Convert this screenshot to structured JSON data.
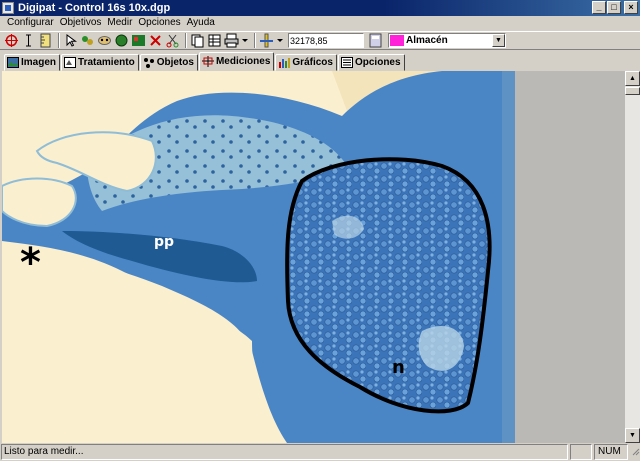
{
  "window": {
    "title": "Digipat - Control 16s 10x.dgp",
    "minimize": "_",
    "maximize": "□",
    "close": "×"
  },
  "menu": [
    "Configurar",
    "Objetivos",
    "Medir",
    "Opciones",
    "Ayuda"
  ],
  "toolbar": {
    "coord_value": "32178,85",
    "combo_value": "Almacén",
    "combo_swatch": "#ff22d8"
  },
  "tabs": [
    {
      "label": "Imagen"
    },
    {
      "label": "Tratamiento"
    },
    {
      "label": "Objetos"
    },
    {
      "label": "Mediciones",
      "active": true
    },
    {
      "label": "Gráficos"
    },
    {
      "label": "Opciones"
    }
  ],
  "image": {
    "labels": {
      "asterisk": "*",
      "pp": "pp",
      "n": "n"
    }
  },
  "status": {
    "text": "Listo para medir...",
    "num": "NUM"
  },
  "colors": {
    "titlebar": "#0a246a",
    "tissue_blue": "#3f79bf",
    "background": "#faefcf"
  }
}
